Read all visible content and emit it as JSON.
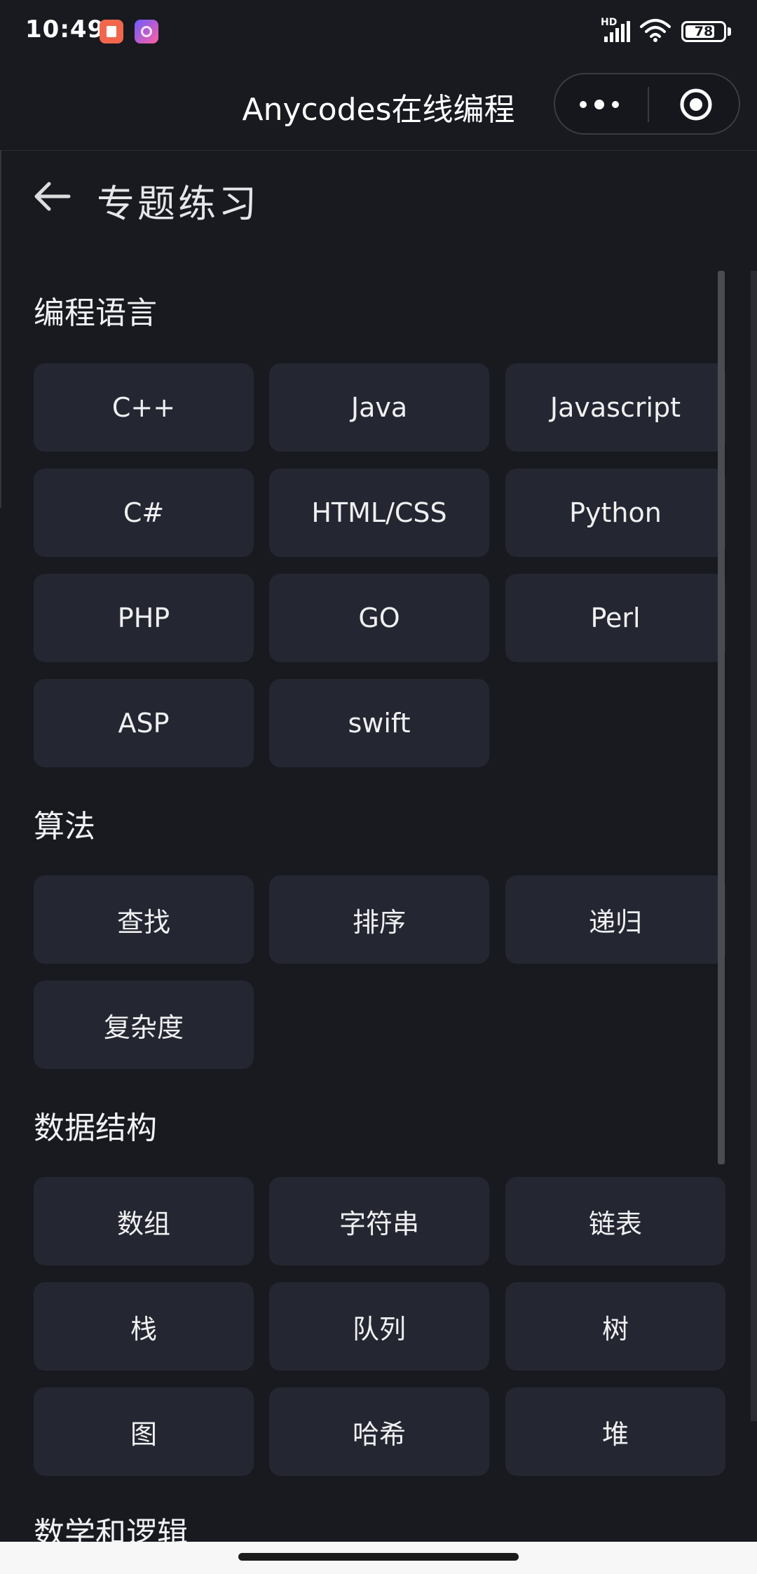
{
  "status_bar": {
    "time": "10:49",
    "network_label": "HD",
    "battery": "78",
    "battery_level": 0.78,
    "icons": [
      "app-notification-icon",
      "app-notification-icon-2",
      "signal-icon",
      "wifi-icon",
      "battery-icon"
    ]
  },
  "header": {
    "title": "Anycodes在线编程",
    "icons": [
      "more-icon",
      "target-icon"
    ]
  },
  "page": {
    "title": "专题练习",
    "back_icon": "back-arrow-icon"
  },
  "sections": [
    {
      "title": "编程语言",
      "items": [
        "C++",
        "Java",
        "Javascript",
        "C#",
        "HTML/CSS",
        "Python",
        "PHP",
        "GO",
        "Perl",
        "ASP",
        "swift"
      ]
    },
    {
      "title": "算法",
      "items": [
        "查找",
        "排序",
        "递归",
        "复杂度"
      ]
    },
    {
      "title": "数据结构",
      "items": [
        "数组",
        "字符串",
        "链表",
        "栈",
        "队列",
        "树",
        "图",
        "哈希",
        "堆"
      ]
    },
    {
      "title": "数学和逻辑",
      "items": []
    }
  ],
  "colors": {
    "background": "#181a20",
    "tile": "#242731",
    "text": "#f0f0f2"
  }
}
